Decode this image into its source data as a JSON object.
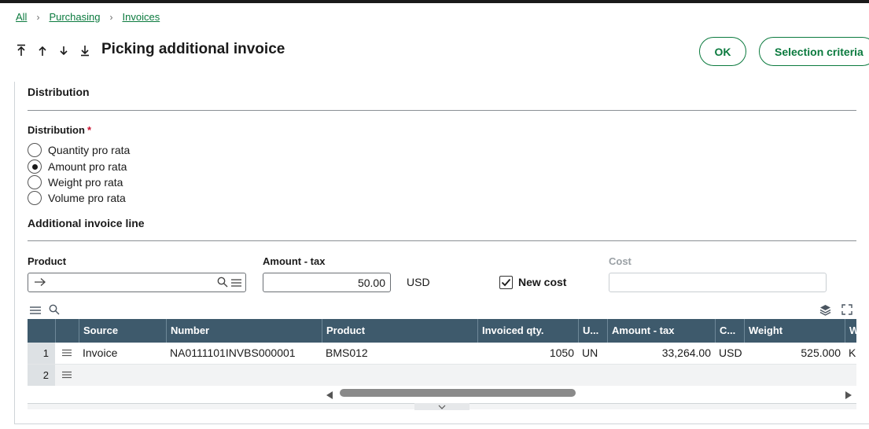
{
  "breadcrumb": {
    "items": [
      "All",
      "Purchasing",
      "Invoices"
    ]
  },
  "page": {
    "title": "Picking additional invoice"
  },
  "actions": {
    "ok_label": "OK",
    "selection_label": "Selection criteria"
  },
  "distribution": {
    "section_title": "Distribution",
    "field_label": "Distribution",
    "required_mark": "*",
    "options": [
      {
        "label": "Quantity pro rata",
        "selected": false
      },
      {
        "label": "Amount pro rata",
        "selected": true
      },
      {
        "label": "Weight pro rata",
        "selected": false
      },
      {
        "label": "Volume pro rata",
        "selected": false
      }
    ]
  },
  "invoice_line": {
    "section_title": "Additional invoice line",
    "product_label": "Product",
    "product_value": "",
    "amount_label": "Amount - tax",
    "amount_value": "50.00",
    "currency": "USD",
    "new_cost_label": "New cost",
    "new_cost_checked": true,
    "cost_label": "Cost",
    "cost_value": ""
  },
  "grid": {
    "columns": [
      "",
      "",
      "Source",
      "Number",
      "Product",
      "Invoiced qty.",
      "U...",
      "Amount - tax",
      "C...",
      "Weight",
      "W"
    ],
    "rows": [
      {
        "num": "1",
        "source": "Invoice",
        "number": "NA0111101INVBS000001",
        "product": "BMS012",
        "qty": "1050",
        "unit": "UN",
        "amount": "33,264.00",
        "currency": "USD",
        "weight": "525.000",
        "w": "K"
      },
      {
        "num": "2",
        "source": "",
        "number": "",
        "product": "",
        "qty": "",
        "unit": "",
        "amount": "",
        "currency": "",
        "weight": "",
        "w": ""
      }
    ]
  },
  "colors": {
    "accent": "#0b7a3e",
    "header": "#3e5a6c",
    "required": "#c8102e"
  },
  "icons": [
    "arrow-first-icon",
    "arrow-up-icon",
    "arrow-down-icon",
    "arrow-last-icon",
    "lookup-arrow-icon",
    "search-icon",
    "menu-icon",
    "layers-icon",
    "expand-icon",
    "chevron-down-icon",
    "scroll-left-icon",
    "scroll-right-icon"
  ]
}
